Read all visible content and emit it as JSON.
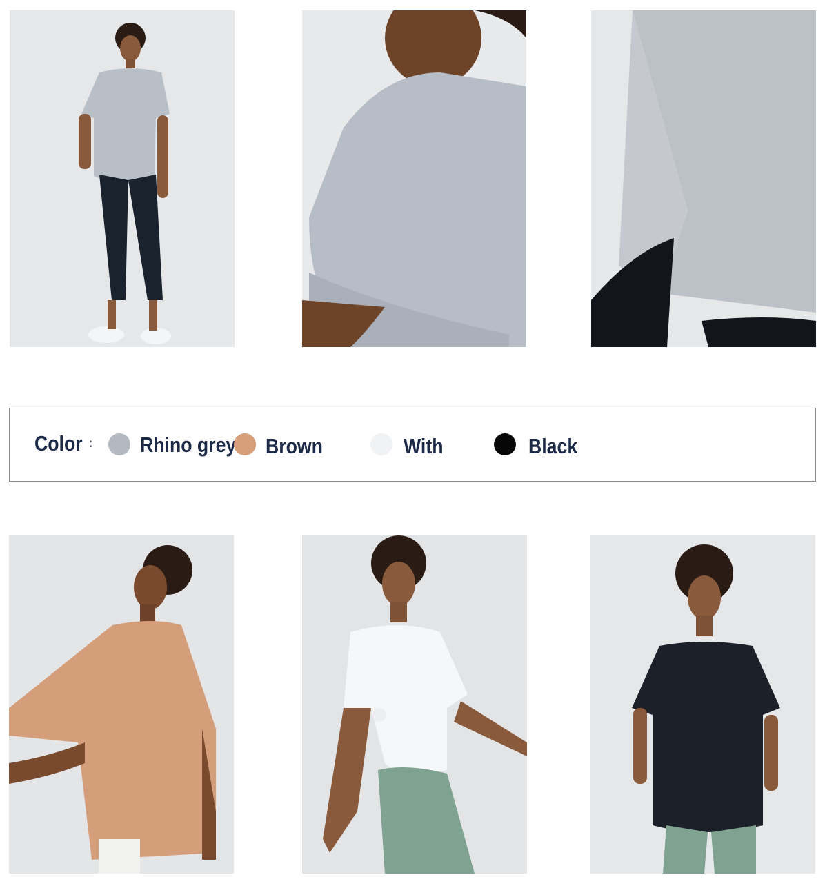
{
  "photos": [
    {
      "id": "grey-full-body",
      "shirt": "#b9bfc7",
      "alt": "Model in rhino grey mesh tee"
    },
    {
      "id": "grey-shoulder-detail",
      "shirt": "#b7bdc6",
      "alt": "Shoulder and sleeve detail"
    },
    {
      "id": "grey-side-slit-detail",
      "shirt": "#bcc1c8",
      "alt": "Side slit hem detail"
    },
    {
      "id": "brown-side-view",
      "shirt": "#d49e7b",
      "alt": "Model in brown mesh tee"
    },
    {
      "id": "white-knotted",
      "shirt": "#f6f7f9",
      "alt": "Model in white mesh tee"
    },
    {
      "id": "black-front",
      "shirt": "#1c2029",
      "alt": "Model in black mesh tee"
    }
  ],
  "color_selector": {
    "label": "Color",
    "separator": ":",
    "options": [
      {
        "name": "Rhino grey",
        "swatch": "#b3b9c1"
      },
      {
        "name": "Brown",
        "swatch": "#d79e7c"
      },
      {
        "name": "With",
        "swatch": "#f1f2f4"
      },
      {
        "name": "Black",
        "swatch": "#070707"
      }
    ]
  }
}
